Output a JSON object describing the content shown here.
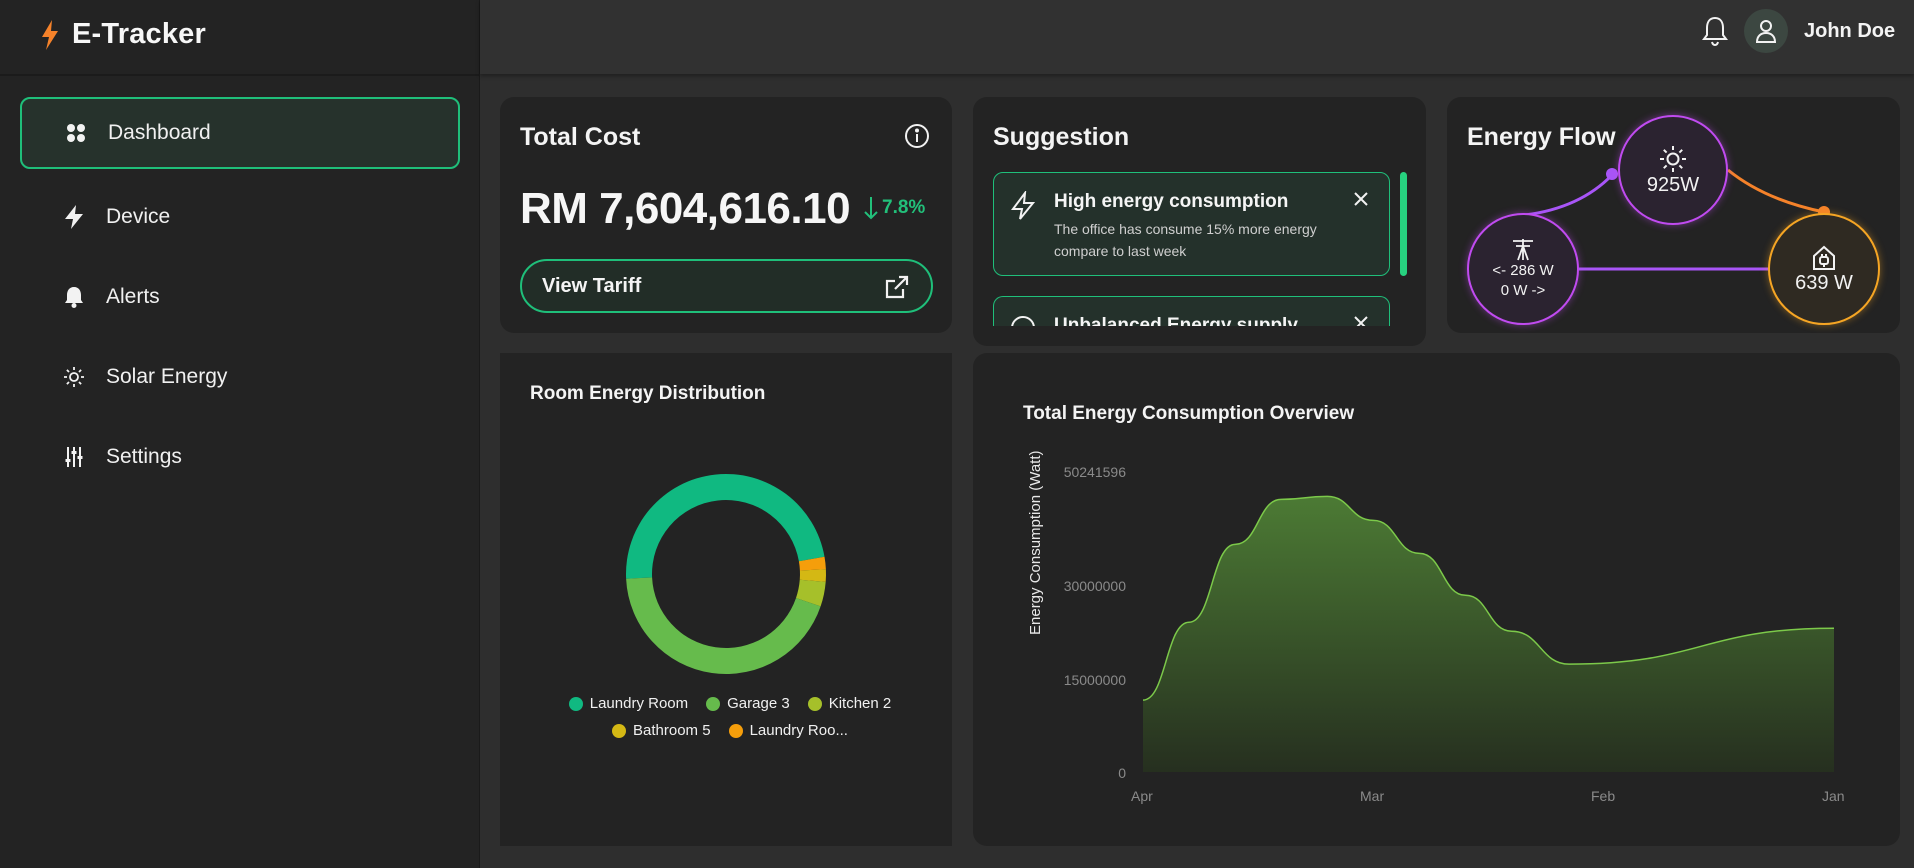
{
  "app": {
    "title": "E-Tracker"
  },
  "sidebar": {
    "items": [
      {
        "label": "Dashboard",
        "active": true,
        "icon": "grid-icon"
      },
      {
        "label": "Device",
        "icon": "bolt-icon"
      },
      {
        "label": "Alerts",
        "icon": "bell-icon"
      },
      {
        "label": "Solar Energy",
        "icon": "sun-icon"
      },
      {
        "label": "Settings",
        "icon": "sliders-icon"
      }
    ]
  },
  "header": {
    "user_name": "John Doe"
  },
  "total_cost": {
    "title": "Total Cost",
    "value": "RM 7,604,616.10",
    "change": "7.8%",
    "button_label": "View Tariff"
  },
  "suggestion": {
    "title": "Suggestion",
    "items": [
      {
        "title": "High energy consumption",
        "text": "The office has consume 15% more energy compare to last week"
      },
      {
        "title": "Unbalanced Energy supply"
      }
    ]
  },
  "energy_flow": {
    "title": "Energy Flow",
    "solar": "925W",
    "grid_in": "<- 286 W",
    "grid_out": "0 W ->",
    "home": "639 W"
  },
  "room_distribution": {
    "title": "Room Energy Distribution",
    "legend": [
      "Laundry Room",
      "Garage 3",
      "Kitchen 2",
      "Bathroom 5",
      "Laundry Roo..."
    ]
  },
  "overview": {
    "title": "Total Energy Consumption Overview"
  },
  "colors": {
    "accent": "#1fbf7a",
    "solar_node": "#c04bf0",
    "home_node": "#f5a524",
    "area_line": "#7cc94a"
  },
  "chart_data": [
    {
      "type": "pie",
      "title": "Room Energy Distribution",
      "categories": [
        "Laundry Room",
        "Garage 3",
        "Kitchen 2",
        "Bathroom 5",
        "Laundry Roo..."
      ],
      "values": [
        48,
        44,
        4,
        2,
        2
      ],
      "colors": [
        "#10b981",
        "#66bb4c",
        "#a6c02a",
        "#d4b814",
        "#f59e0b"
      ],
      "donut": true,
      "legend": "bottom"
    },
    {
      "type": "area",
      "title": "Total Energy Consumption Overview",
      "ylabel": "Energy Consumption (Watt)",
      "xlabel": "",
      "x": [
        "Apr",
        "Mar",
        "Feb",
        "Jan"
      ],
      "y_ticks": [
        "0",
        "15000000",
        "30000000",
        "50241596"
      ],
      "ylim": [
        0,
        50241596
      ],
      "points": [
        {
          "x": 0,
          "y": 12000000
        },
        {
          "x": 0.2,
          "y": 25000000
        },
        {
          "x": 0.4,
          "y": 38000000
        },
        {
          "x": 0.6,
          "y": 45500000
        },
        {
          "x": 0.8,
          "y": 46000000
        },
        {
          "x": 1.0,
          "y": 42000000
        },
        {
          "x": 1.2,
          "y": 36500000
        },
        {
          "x": 1.4,
          "y": 29500000
        },
        {
          "x": 1.6,
          "y": 23500000
        },
        {
          "x": 1.85,
          "y": 18000000
        },
        {
          "x": 3.0,
          "y": 24000000
        }
      ]
    }
  ]
}
